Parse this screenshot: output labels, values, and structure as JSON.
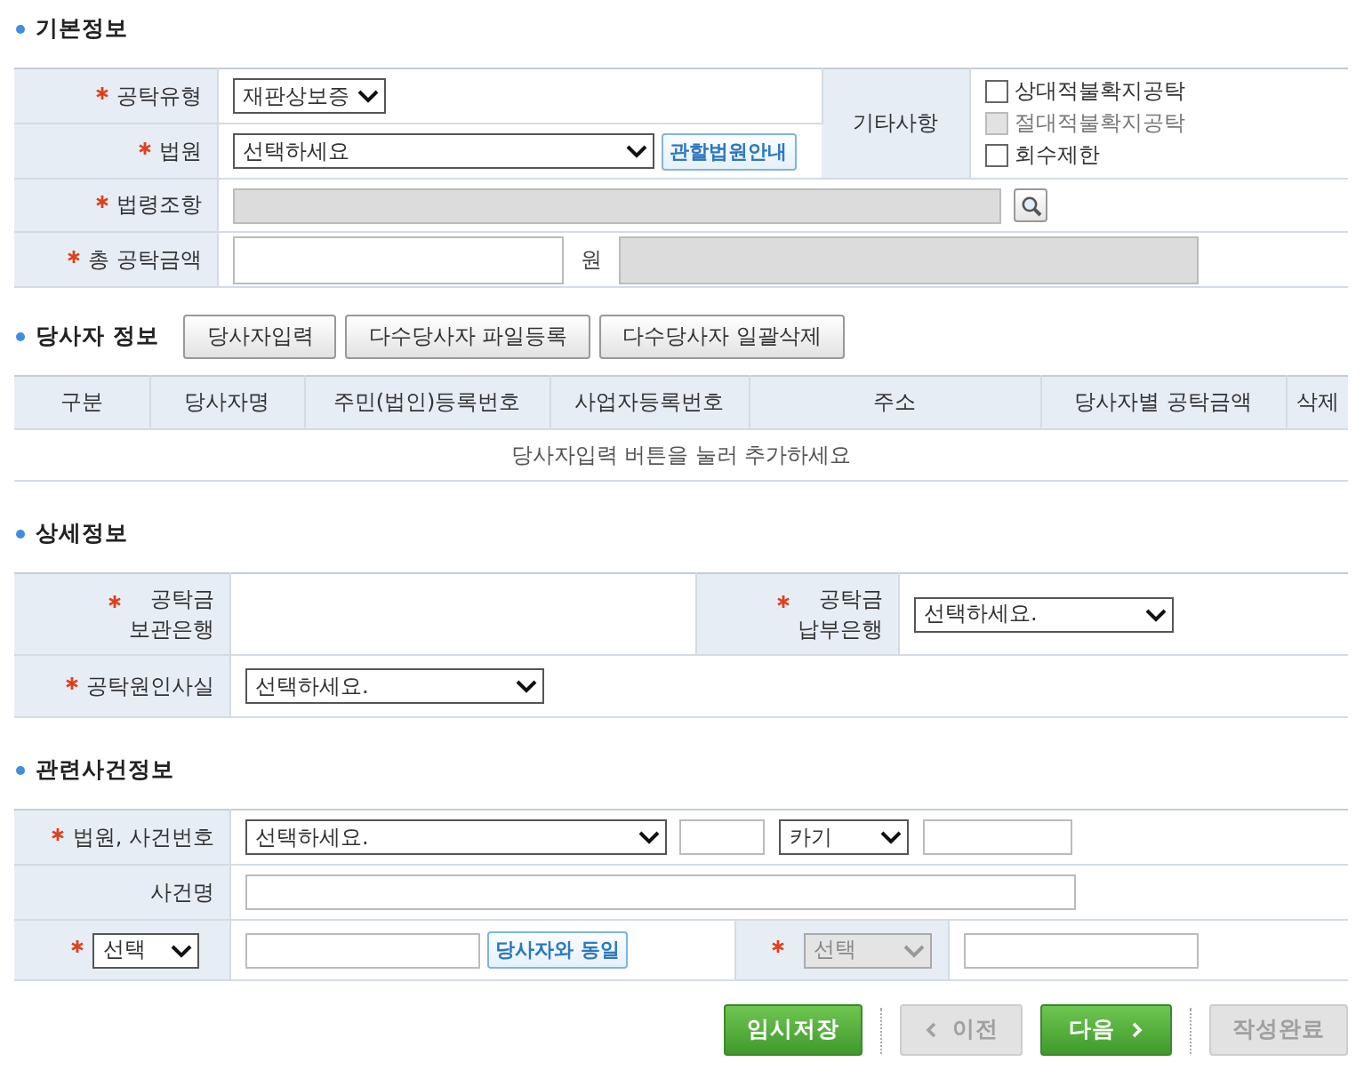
{
  "basic_info": {
    "title": "기본정보",
    "deposit_type": {
      "label": "공탁유형",
      "required": true,
      "value": "재판상보증"
    },
    "court": {
      "label": "법원",
      "required": true,
      "value": "선택하세요",
      "button": "관할법원안내"
    },
    "law_article": {
      "label": "법령조항",
      "required": true
    },
    "total_amount": {
      "label": "총 공탁금액",
      "required": true,
      "unit": "원"
    },
    "other": {
      "label": "기타사항",
      "options": [
        {
          "label": "상대적불확지공탁",
          "checked": false,
          "disabled": false
        },
        {
          "label": "절대적불확지공탁",
          "checked": false,
          "disabled": true
        },
        {
          "label": "회수제한",
          "checked": false,
          "disabled": false
        }
      ]
    }
  },
  "parties": {
    "title": "당사자 정보",
    "buttons": [
      "당사자입력",
      "다수당사자 파일등록",
      "다수당사자 일괄삭제"
    ],
    "columns": [
      "구분",
      "당사자명",
      "주민(법인)등록번호",
      "사업자등록번호",
      "주소",
      "당사자별 공탁금액",
      "삭제"
    ],
    "empty_message": "당사자입력 버튼을 눌러 추가하세요"
  },
  "details": {
    "title": "상세정보",
    "custody_bank": {
      "label_lines": [
        "공탁금",
        "보관은행"
      ],
      "required": true
    },
    "payment_bank": {
      "label_lines": [
        "공탁금",
        "납부은행"
      ],
      "required": true,
      "value": "선택하세요."
    },
    "cause": {
      "label": "공탁원인사실",
      "required": true,
      "value": "선택하세요."
    }
  },
  "related_case": {
    "title": "관련사건정보",
    "court_case": {
      "label": "법원, 사건번호",
      "required": true,
      "court": "선택하세요.",
      "case_type": "카기"
    },
    "case_name": {
      "label": "사건명",
      "required": false
    },
    "party_row": {
      "required": true,
      "select": "선택",
      "same_button": "당사자와 동일",
      "select2": {
        "value": "선택",
        "disabled": true,
        "required": true
      }
    }
  },
  "actions": [
    {
      "label": "임시저장",
      "kind": "green",
      "disabled": false
    },
    {
      "label": "이전",
      "kind": "prev",
      "disabled": true
    },
    {
      "label": "다음",
      "kind": "next",
      "disabled": false
    },
    {
      "label": "작성완료",
      "kind": "plain",
      "disabled": true
    }
  ]
}
